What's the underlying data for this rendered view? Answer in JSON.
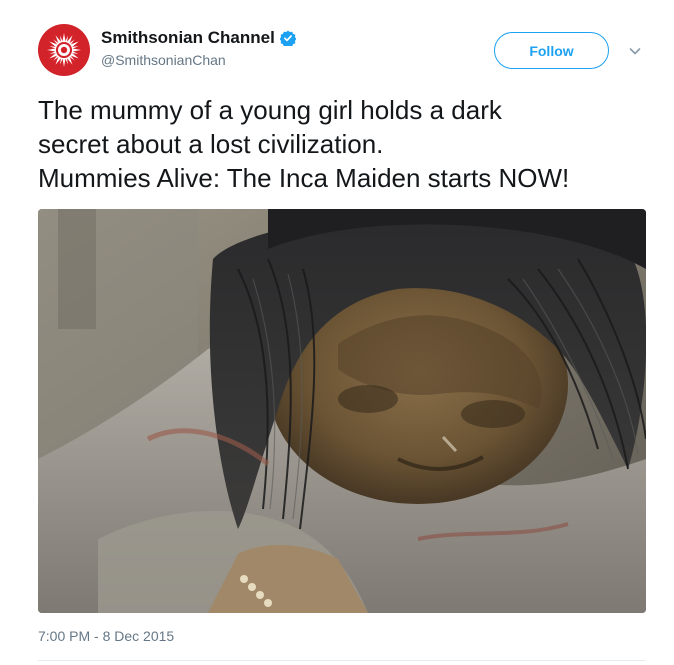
{
  "author": {
    "name": "Smithsonian Channel",
    "handle": "@SmithsonianChan",
    "verified": true,
    "verified_icon": "verified-badge-icon",
    "avatar_icon": "smithsonian-sunburst-logo"
  },
  "actions": {
    "follow_label": "Follow",
    "more_icon": "chevron-down-icon"
  },
  "tweet": {
    "lines": [
      "The mummy of a young girl holds a dark",
      "secret about a lost civilization.",
      "Mummies Alive: The Inca Maiden starts NOW!"
    ],
    "timestamp": "7:00 PM - 8 Dec 2015"
  },
  "colors": {
    "brand_blue": "#1da1f2",
    "avatar_red": "#d2232a",
    "secondary_text": "#657786",
    "primary_text": "#14171a"
  }
}
